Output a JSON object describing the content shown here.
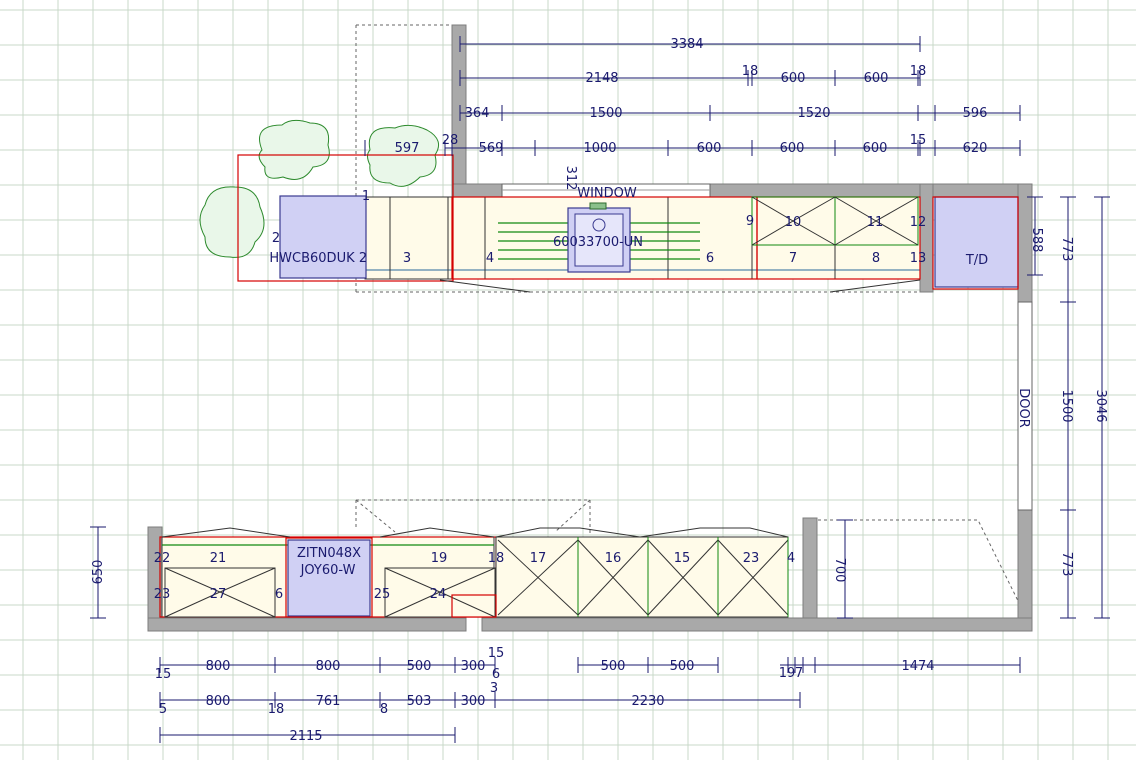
{
  "dimensions": {
    "top_overall": "3384",
    "top_row2": [
      "2148",
      "18",
      "600",
      "600",
      "18"
    ],
    "top_row3": [
      "364",
      "1500",
      "1520",
      "596"
    ],
    "top_row4": [
      "28",
      "597",
      "569",
      "1000",
      "600",
      "600",
      "600",
      "15",
      "620"
    ],
    "window_offset": "312",
    "right_depth_upper": "588",
    "right_773_top": "773",
    "right_1500": "1500",
    "right_773_bottom": "773",
    "right_total": "3046",
    "left_650": "650",
    "mid_700": "700",
    "bottom_row1": [
      "800",
      "800",
      "500",
      "300",
      "500",
      "500",
      "1474"
    ],
    "bottom_row1_small": [
      "15",
      "15",
      "6",
      "19",
      "7"
    ],
    "bottom_row2": [
      "800",
      "761",
      "503",
      "300",
      "2230"
    ],
    "bottom_row2_small": [
      "5",
      "18",
      "8",
      "3"
    ],
    "bottom_total": "2115"
  },
  "labels": {
    "window": "WINDOW",
    "door": "DOOR",
    "td": "T/D",
    "hob_model": "HWCB60DUK",
    "sink_model": "60033700-UN",
    "appliance_model": "JOY60-W",
    "appliance_model_partial": "ZITN048X"
  },
  "top_unit_numbers": [
    "1",
    "2",
    "2",
    "3",
    "4",
    "6",
    "7",
    "8",
    "9",
    "10",
    "11",
    "12",
    "13"
  ],
  "bottom_unit_numbers": [
    "22",
    "21",
    "19",
    "18",
    "17",
    "16",
    "15",
    "23",
    "4",
    "23",
    "27",
    "6",
    "25",
    "24"
  ],
  "colors": {
    "wall": "#a9a9a9",
    "dimension": "#1a1a6e",
    "outline_red": "#d40000",
    "rail_green": "#108a10",
    "appliance": "#d0d0f4",
    "grid": "#c8d8c8"
  }
}
